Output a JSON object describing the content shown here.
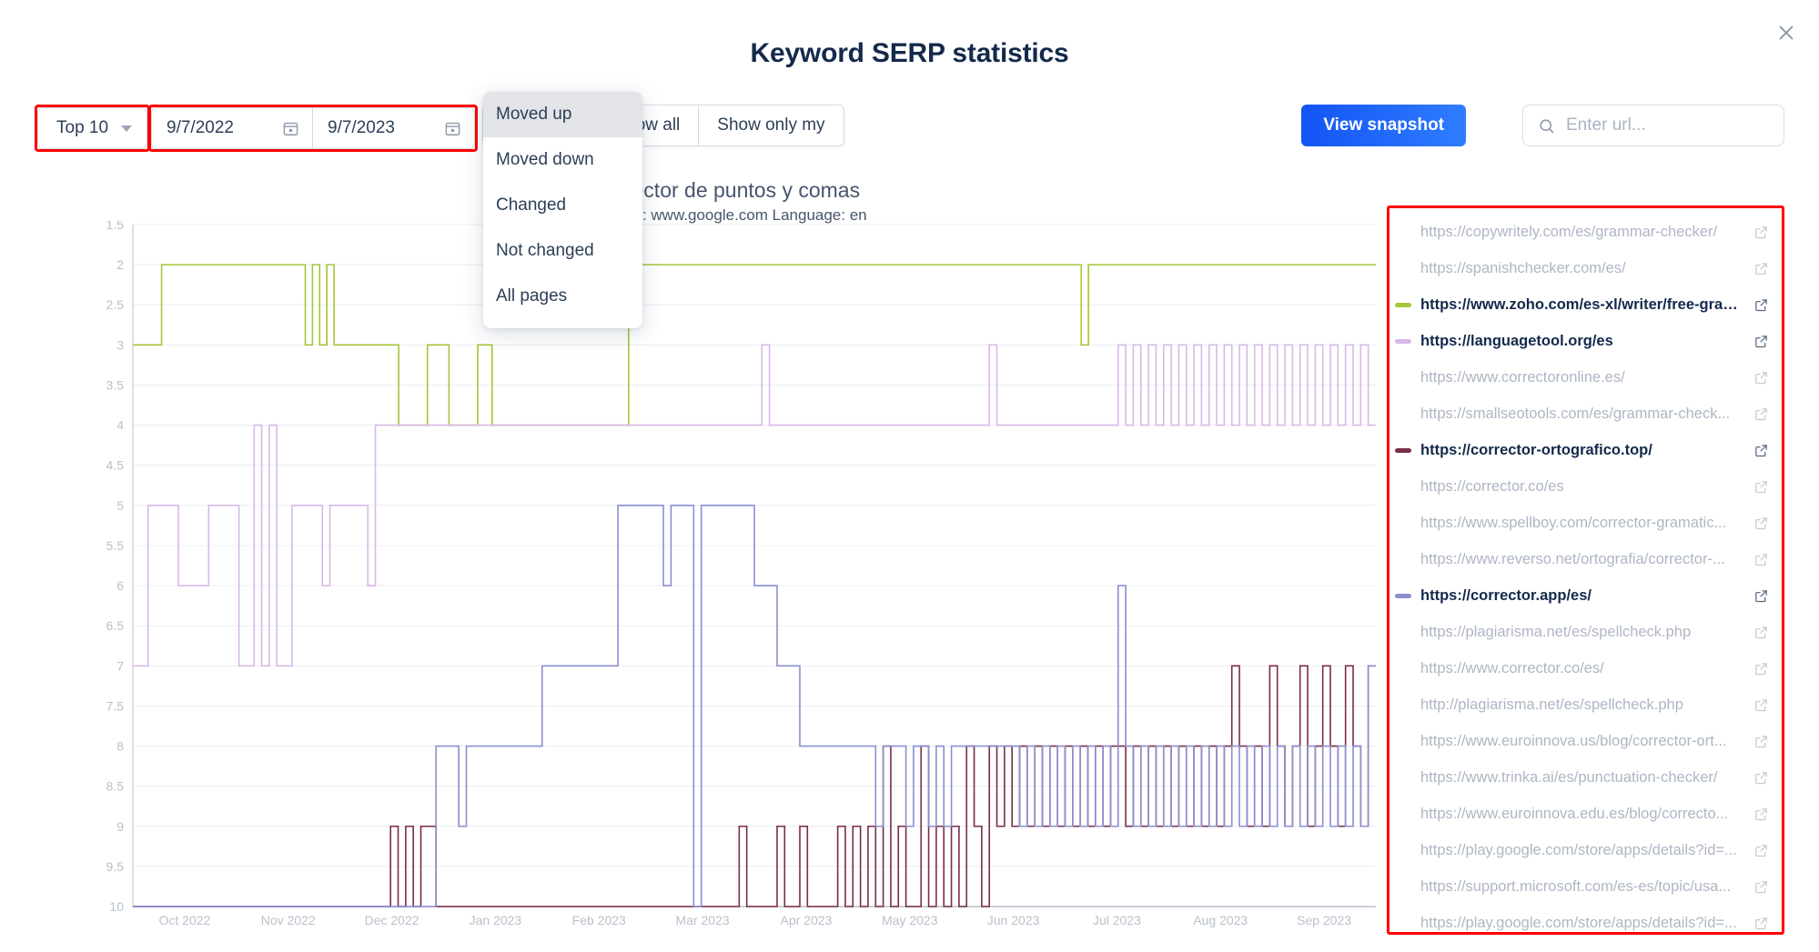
{
  "header": {
    "title": "Keyword SERP statistics",
    "close_icon": "close-icon"
  },
  "toolbar": {
    "top_filter": {
      "label": "Top 10",
      "caret_icon": "chevron-down-icon"
    },
    "date_from": {
      "value": "9/7/2022",
      "icon": "calendar-icon"
    },
    "date_to": {
      "value": "9/7/2023",
      "icon": "calendar-icon"
    },
    "segments": [
      {
        "label": "Moved up"
      },
      {
        "label": "Show all"
      },
      {
        "label": "Show only my"
      }
    ],
    "dropdown": {
      "open": true,
      "items": [
        {
          "label": "Moved up",
          "active": true
        },
        {
          "label": "Moved down",
          "active": false
        },
        {
          "label": "Changed",
          "active": false
        },
        {
          "label": "Not changed",
          "active": false
        },
        {
          "label": "All pages",
          "active": false
        }
      ]
    },
    "snapshot_button": {
      "label": "View snapshot",
      "color": "#1354f5"
    },
    "search": {
      "value": "",
      "placeholder": "Enter url...",
      "icon": "search-icon"
    }
  },
  "chart_data": {
    "type": "line",
    "title": "corrector de puntos y comas",
    "subtitle": "Domain: www.google.com Language: en",
    "xlabel": "",
    "ylabel": "",
    "grid": true,
    "legend_position": "right",
    "y_inverted": true,
    "ylim": [
      1.5,
      10
    ],
    "yticks": [
      "1.5",
      "2",
      "2.5",
      "3",
      "3.5",
      "4",
      "4.5",
      "5",
      "5.5",
      "6",
      "6.5",
      "7",
      "7.5",
      "8",
      "8.5",
      "9",
      "9.5",
      "10"
    ],
    "xticks": [
      "Oct 2022",
      "Nov 2022",
      "Dec 2022",
      "Jan 2023",
      "Feb 2023",
      "Mar 2023",
      "Apr 2023",
      "May 2023",
      "Jun 2023",
      "Jul 2023",
      "Aug 2023",
      "Sep 2023"
    ],
    "series": [
      {
        "name": "https://www.zoho.com/es-xl/writer/free-gram...",
        "color": "#a4c639",
        "values": [
          3,
          3,
          3,
          3,
          2,
          2,
          2,
          2,
          2,
          2,
          2,
          2,
          2,
          2,
          2,
          2,
          2,
          2,
          2,
          2,
          2,
          2,
          2,
          2,
          3,
          2,
          3,
          2,
          3,
          3,
          3,
          3,
          3,
          3,
          3,
          3,
          3,
          4,
          4,
          4,
          4,
          3,
          3,
          3,
          4,
          4,
          4,
          4,
          3,
          3,
          4,
          4,
          4,
          4,
          4,
          4,
          4,
          4,
          4,
          4,
          4,
          4,
          4,
          4,
          4,
          4,
          4,
          4,
          4,
          2,
          2,
          2,
          2,
          2,
          2,
          2,
          2,
          2,
          2,
          2,
          2,
          2,
          2,
          2,
          2,
          2,
          2,
          2,
          2,
          2,
          2,
          2,
          2,
          2,
          2,
          2,
          2,
          2,
          2,
          2,
          2,
          2,
          2,
          2,
          2,
          2,
          2,
          2,
          2,
          2,
          2,
          2,
          2,
          2,
          2,
          2,
          2,
          2,
          2,
          2,
          2,
          2,
          2,
          2,
          2,
          2,
          2,
          2,
          2,
          2,
          2,
          2,
          3,
          2,
          2,
          2,
          2,
          2,
          2,
          2,
          2,
          2,
          2,
          2,
          2,
          2,
          2,
          2,
          2,
          2,
          2,
          2,
          2,
          2,
          2,
          2,
          2,
          2,
          2,
          2,
          2,
          2,
          2,
          2,
          2,
          2,
          2,
          2,
          2,
          2,
          2,
          2,
          2
        ]
      },
      {
        "name": "https://languagetool.org/es",
        "color": "#d9b8e8",
        "values": [
          7,
          7,
          5,
          5,
          5,
          5,
          6,
          6,
          6,
          6,
          5,
          5,
          5,
          5,
          7,
          7,
          4,
          7,
          4,
          7,
          7,
          5,
          5,
          5,
          5,
          6,
          5,
          5,
          5,
          5,
          5,
          6,
          4,
          4,
          4,
          4,
          4,
          4,
          4,
          4,
          4,
          4,
          4,
          4,
          4,
          4,
          4,
          4,
          4,
          4,
          4,
          4,
          4,
          4,
          4,
          4,
          4,
          4,
          4,
          4,
          4,
          4,
          4,
          4,
          4,
          4,
          4,
          4,
          4,
          4,
          4,
          4,
          4,
          4,
          4,
          4,
          4,
          4,
          4,
          4,
          4,
          4,
          4,
          3,
          4,
          4,
          4,
          4,
          4,
          4,
          4,
          4,
          4,
          4,
          4,
          4,
          4,
          4,
          4,
          4,
          4,
          4,
          4,
          4,
          4,
          4,
          4,
          4,
          4,
          4,
          4,
          4,
          4,
          3,
          4,
          4,
          4,
          4,
          4,
          4,
          4,
          4,
          4,
          4,
          4,
          4,
          4,
          4,
          4,
          4,
          3,
          4,
          3,
          4,
          3,
          4,
          3,
          4,
          3,
          4,
          3,
          4,
          3,
          4,
          3,
          4,
          3,
          4,
          3,
          4,
          3,
          4,
          3,
          4,
          3,
          4,
          3,
          4,
          3,
          4,
          3,
          4,
          3,
          4
        ]
      },
      {
        "name": "https://corrector-ortografico.top/",
        "color": "#7a2d4a",
        "values": [
          10,
          10,
          10,
          10,
          10,
          10,
          10,
          10,
          10,
          10,
          10,
          10,
          10,
          10,
          10,
          10,
          10,
          10,
          10,
          10,
          10,
          10,
          10,
          10,
          10,
          10,
          10,
          10,
          10,
          10,
          10,
          10,
          10,
          10,
          9,
          10,
          9,
          10,
          9,
          9,
          10,
          10,
          10,
          10,
          10,
          10,
          10,
          10,
          10,
          10,
          10,
          10,
          10,
          10,
          10,
          10,
          10,
          10,
          10,
          10,
          10,
          10,
          10,
          10,
          10,
          10,
          10,
          10,
          10,
          10,
          10,
          10,
          10,
          10,
          10,
          10,
          10,
          10,
          10,
          10,
          9,
          10,
          10,
          10,
          10,
          9,
          10,
          10,
          9,
          10,
          10,
          10,
          10,
          9,
          10,
          9,
          10,
          9,
          10,
          8,
          10,
          9,
          10,
          10,
          8,
          10,
          9,
          10,
          9,
          10,
          8,
          9,
          10,
          8,
          9,
          8,
          9,
          8,
          9,
          8,
          9,
          8,
          9,
          8,
          9,
          8,
          9,
          8,
          9,
          8,
          8,
          9,
          8,
          9,
          8,
          9,
          8,
          9,
          8,
          9,
          8,
          9,
          8,
          9,
          8,
          7,
          8,
          9,
          8,
          9,
          7,
          8,
          9,
          8,
          7,
          9,
          8,
          7,
          8,
          9,
          7,
          8,
          9,
          7
        ]
      },
      {
        "name": "https://corrector.app/es/",
        "color": "#8b8fd0",
        "values": [
          10,
          10,
          10,
          10,
          10,
          10,
          10,
          10,
          10,
          10,
          10,
          10,
          10,
          10,
          10,
          10,
          10,
          10,
          10,
          10,
          10,
          10,
          10,
          10,
          10,
          10,
          10,
          10,
          10,
          10,
          10,
          10,
          10,
          10,
          10,
          10,
          10,
          10,
          10,
          10,
          8,
          8,
          8,
          9,
          8,
          8,
          8,
          8,
          8,
          8,
          8,
          8,
          8,
          8,
          7,
          7,
          7,
          7,
          7,
          7,
          7,
          7,
          7,
          7,
          5,
          5,
          5,
          5,
          5,
          5,
          6,
          5,
          5,
          5,
          10,
          5,
          5,
          5,
          5,
          5,
          5,
          5,
          6,
          6,
          6,
          7,
          7,
          7,
          8,
          8,
          8,
          8,
          8,
          8,
          8,
          8,
          8,
          8,
          9,
          8,
          8,
          8,
          9,
          8,
          8,
          9,
          8,
          9,
          8,
          8,
          8,
          8,
          8,
          8,
          8,
          8,
          8,
          9,
          8,
          9,
          8,
          9,
          8,
          9,
          8,
          9,
          8,
          9,
          8,
          9,
          6,
          8,
          9,
          8,
          9,
          8,
          9,
          8,
          9,
          8,
          9,
          8,
          9,
          8,
          9,
          8,
          9,
          8,
          9,
          8,
          9,
          8,
          9,
          8,
          9,
          8,
          9,
          8,
          9,
          8,
          9,
          8,
          9,
          7
        ]
      }
    ]
  },
  "url_panel": {
    "ext_icon": "external-link-icon",
    "urls": [
      {
        "label": "https://copywritely.com/es/grammar-checker/",
        "active": false,
        "color": null
      },
      {
        "label": "https://spanishchecker.com/es/",
        "active": false,
        "color": null
      },
      {
        "label": "https://www.zoho.com/es-xl/writer/free-gram...",
        "active": true,
        "color": "#a4c639"
      },
      {
        "label": "https://languagetool.org/es",
        "active": true,
        "color": "#d9b8e8"
      },
      {
        "label": "https://www.correctoronline.es/",
        "active": false,
        "color": null
      },
      {
        "label": "https://smallseotools.com/es/grammar-check...",
        "active": false,
        "color": null
      },
      {
        "label": "https://corrector-ortografico.top/",
        "active": true,
        "color": "#7a2d4a"
      },
      {
        "label": "https://corrector.co/es",
        "active": false,
        "color": null
      },
      {
        "label": "https://www.spellboy.com/corrector-gramatic...",
        "active": false,
        "color": null
      },
      {
        "label": "https://www.reverso.net/ortografia/corrector-...",
        "active": false,
        "color": null
      },
      {
        "label": "https://corrector.app/es/",
        "active": true,
        "color": "#8b8fd0"
      },
      {
        "label": "https://plagiarisma.net/es/spellcheck.php",
        "active": false,
        "color": null
      },
      {
        "label": "https://www.corrector.co/es/",
        "active": false,
        "color": null
      },
      {
        "label": "http://plagiarisma.net/es/spellcheck.php",
        "active": false,
        "color": null
      },
      {
        "label": "https://www.euroinnova.us/blog/corrector-ort...",
        "active": false,
        "color": null
      },
      {
        "label": "https://www.trinka.ai/es/punctuation-checker/",
        "active": false,
        "color": null
      },
      {
        "label": "https://www.euroinnova.edu.es/blog/correcto...",
        "active": false,
        "color": null
      },
      {
        "label": "https://play.google.com/store/apps/details?id=...",
        "active": false,
        "color": null
      },
      {
        "label": "https://support.microsoft.com/es-es/topic/usa...",
        "active": false,
        "color": null
      },
      {
        "label": "https://play.google.com/store/apps/details?id=...",
        "active": false,
        "color": null
      }
    ]
  }
}
